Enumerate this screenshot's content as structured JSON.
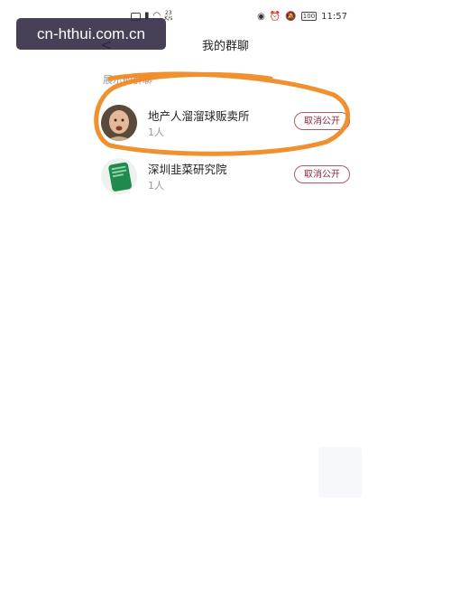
{
  "status_bar": {
    "left_icons": [
      "sim-icon",
      "signal-icon",
      "wifi-icon"
    ],
    "net_speed_value": "23",
    "net_speed_unit": "K/s",
    "right_icons": [
      "eye-icon",
      "alarm-icon",
      "mute-icon"
    ],
    "battery": "100",
    "time": "11:57"
  },
  "watermark": {
    "text": "cn-hthui.com.cn"
  },
  "header": {
    "title": "我的群聊"
  },
  "section": {
    "label": "展示的群聊"
  },
  "groups": [
    {
      "name": "地产人溜溜球贩卖所",
      "count": "1人",
      "action": "取消公开"
    },
    {
      "name": "深圳韭菜研究院",
      "count": "1人",
      "action": "取消公开"
    }
  ],
  "colors": {
    "accent": "#8a2a3a",
    "highlight_stroke": "#f08a24",
    "watermark_bg": "#2e2640"
  }
}
